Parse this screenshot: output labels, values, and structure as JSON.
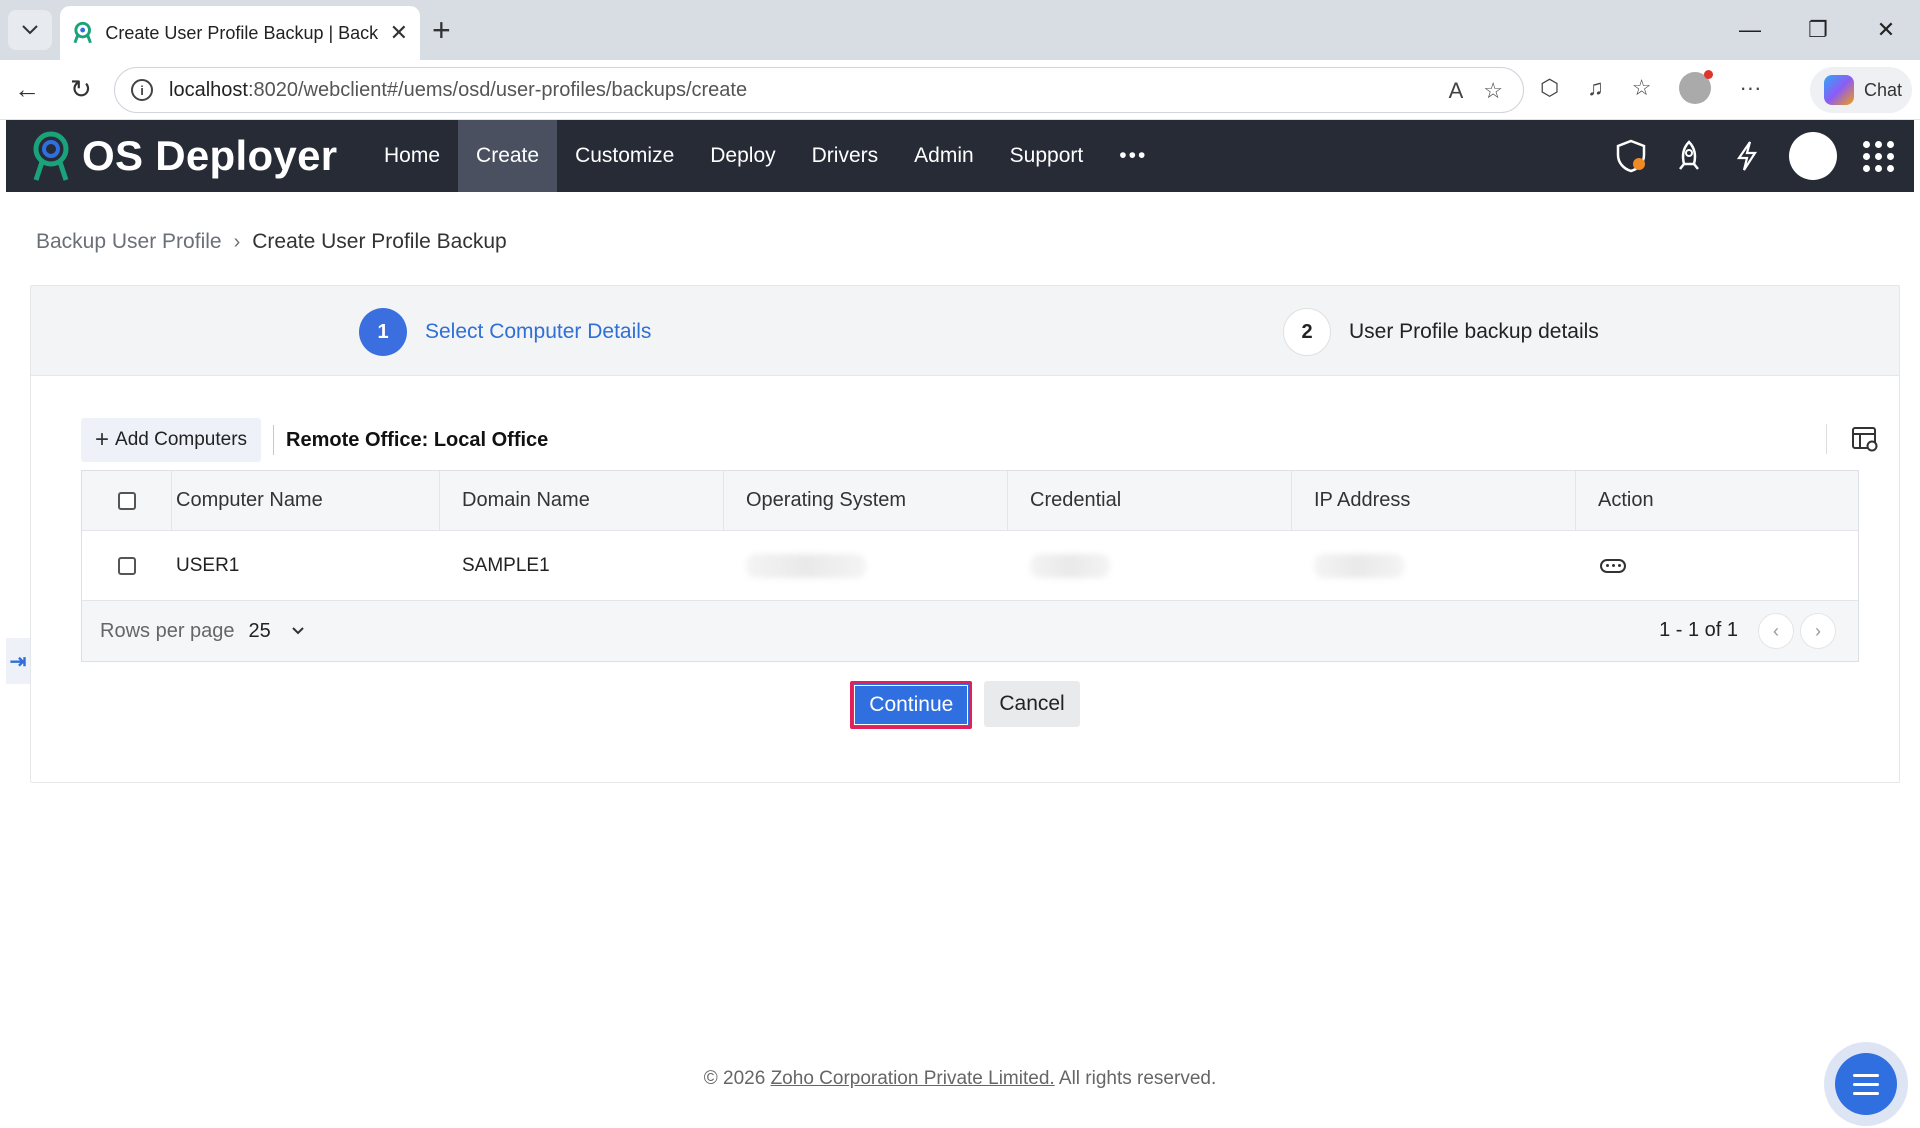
{
  "browser": {
    "tab_title": "Create User Profile Backup | Backup",
    "url_host": "localhost",
    "url_rest": ":8020/webclient#/uems/osd/user-profiles/backups/create",
    "chat_label": "Chat"
  },
  "app": {
    "logo_text": "OS Deployer",
    "nav": [
      "Home",
      "Create",
      "Customize",
      "Deploy",
      "Drivers",
      "Admin",
      "Support"
    ],
    "active_nav": "Create",
    "more": "•••"
  },
  "breadcrumb": {
    "parent": "Backup User Profile",
    "current": "Create User Profile Backup"
  },
  "steps": [
    {
      "num": "1",
      "label": "Select Computer Details",
      "active": true
    },
    {
      "num": "2",
      "label": "User Profile backup details",
      "active": false
    }
  ],
  "toolbar": {
    "add_label": "Add Computers",
    "remote_office": "Remote Office: Local Office"
  },
  "table": {
    "columns": [
      "Computer Name",
      "Domain Name",
      "Operating System",
      "Credential",
      "IP Address",
      "Action"
    ],
    "rows": [
      {
        "computer": "USER1",
        "domain": "SAMPLE1"
      }
    ]
  },
  "pagination": {
    "rows_per_page_label": "Rows per page",
    "rows_per_page": "25",
    "range": "1 - 1 of 1"
  },
  "buttons": {
    "continue": "Continue",
    "cancel": "Cancel"
  },
  "footer": {
    "prefix": "© 2026 ",
    "link": "Zoho Corporation Private Limited.",
    "suffix": " All rights reserved."
  },
  "colors": {
    "accent": "#2f6fe0",
    "header_bg": "#262b36",
    "highlight_border": "#e0215a"
  }
}
